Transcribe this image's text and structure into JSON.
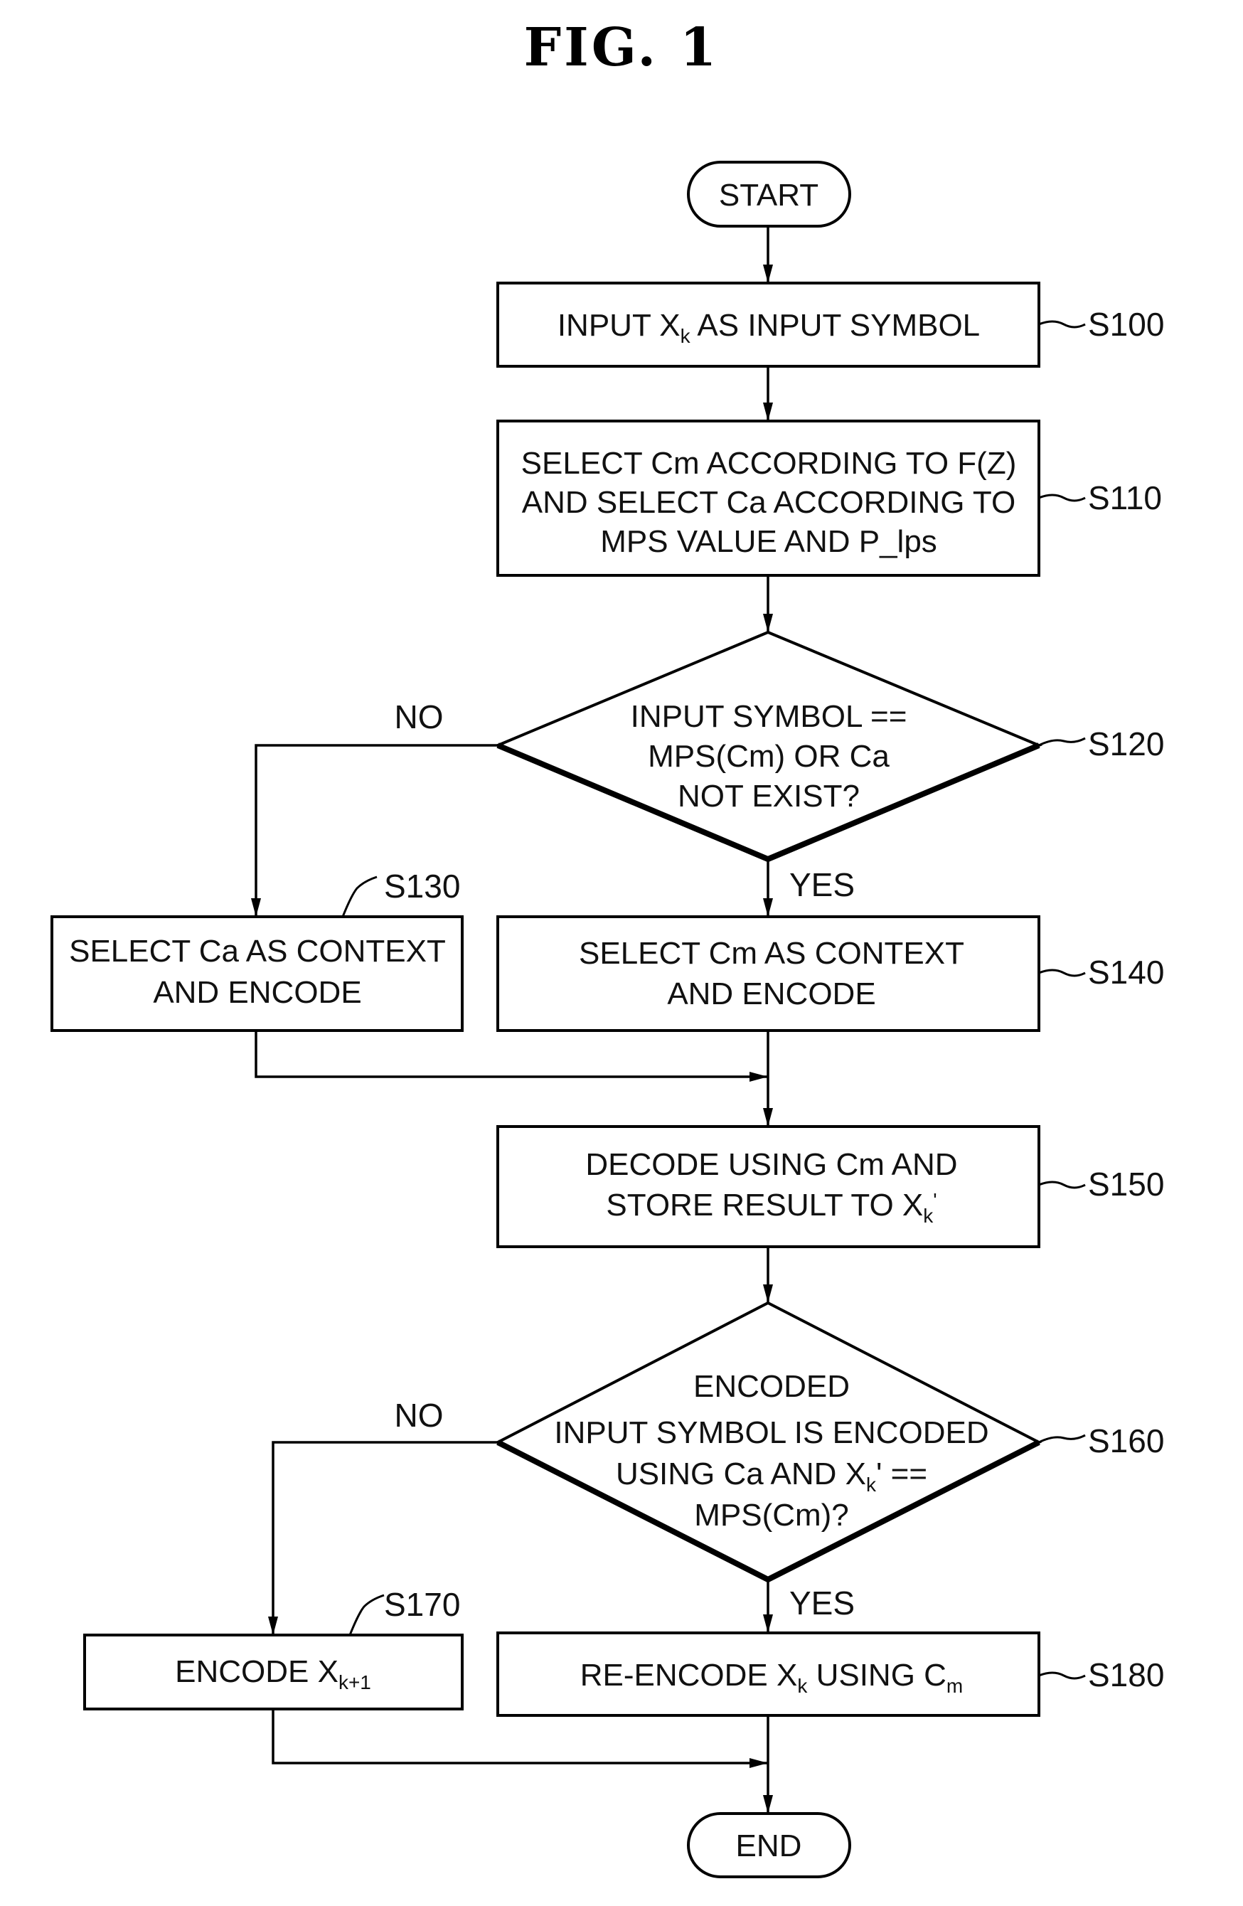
{
  "figure": {
    "title": "FIG.  1"
  },
  "terminals": {
    "start": "START",
    "end": "END"
  },
  "steps": {
    "s100": {
      "ref": "S100",
      "lines": [
        "INPUT X",
        "k",
        " AS INPUT SYMBOL"
      ]
    },
    "s110": {
      "ref": "S110",
      "lines": [
        "SELECT Cm ACCORDING TO F(Z)",
        "AND SELECT Ca ACCORDING TO",
        "MPS VALUE AND P_lps"
      ]
    },
    "s120": {
      "ref": "S120",
      "lines": [
        "INPUT SYMBOL ==",
        "MPS(Cm) OR Ca",
        "NOT EXIST?"
      ],
      "no": "NO",
      "yes": "YES"
    },
    "s130": {
      "ref": "S130",
      "lines": [
        "SELECT Ca AS CONTEXT",
        "AND ENCODE"
      ]
    },
    "s140": {
      "ref": "S140",
      "lines": [
        "SELECT Cm AS CONTEXT",
        "AND ENCODE"
      ]
    },
    "s150": {
      "ref": "S150",
      "lines": [
        "DECODE USING Cm AND",
        "STORE RESULT TO X",
        "k",
        "'"
      ]
    },
    "s160": {
      "ref": "S160",
      "lines": [
        "ENCODED",
        "INPUT SYMBOL IS ENCODED",
        "USING Ca AND X",
        "k",
        "' ==",
        "MPS(Cm)?"
      ],
      "no": "NO",
      "yes": "YES"
    },
    "s170": {
      "ref": "S170",
      "lines": [
        "ENCODE X",
        "k+1"
      ]
    },
    "s180": {
      "ref": "S180",
      "lines": [
        "RE-ENCODE X",
        "k",
        " USING C",
        "m"
      ]
    }
  }
}
